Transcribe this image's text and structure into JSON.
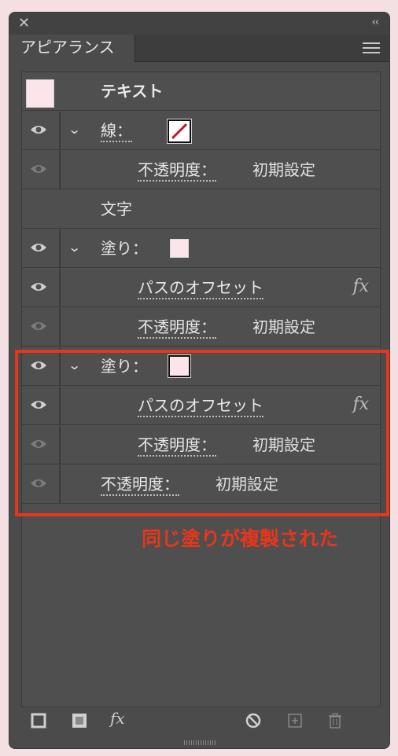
{
  "window": {
    "close_glyph": "✕",
    "collapse_glyph": "‹‹"
  },
  "tab": {
    "label": "アピアランス"
  },
  "rows": {
    "text_label": "テキスト",
    "stroke_label": "線：",
    "stroke_opacity_label": "不透明度：",
    "stroke_opacity_value": "初期設定",
    "moji_label": "文字",
    "fill1_label": "塗り：",
    "fill1_offset_label": "パスのオフセット",
    "fill1_opacity_label": "不透明度：",
    "fill1_opacity_value": "初期設定",
    "fill2_label": "塗り：",
    "fill2_offset_label": "パスのオフセット",
    "fill2_opacity_label": "不透明度：",
    "fill2_opacity_value": "初期設定",
    "opacity_label": "不透明度：",
    "opacity_value": "初期設定",
    "fx_glyph": "fx"
  },
  "annotation": {
    "text": "同じ塗りが複製された"
  },
  "colors": {
    "fill_swatch": "#fbe4ea",
    "highlight": "#e8361b",
    "panel": "#4b4b4b"
  }
}
